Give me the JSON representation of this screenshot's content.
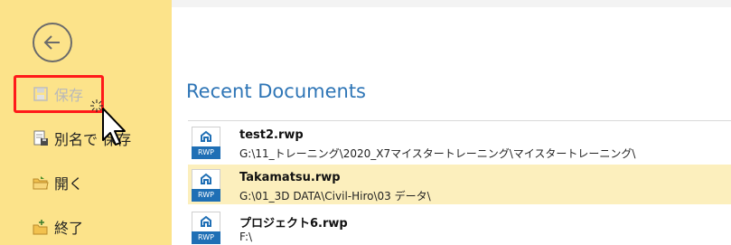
{
  "sidebar": {
    "back_icon": "arrow-left-circle-icon",
    "items": [
      {
        "label": "保存",
        "icon": "save-icon",
        "disabled": true
      },
      {
        "label": "別名で 保存",
        "icon": "save-as-icon"
      },
      {
        "label": "開く",
        "icon": "open-folder-icon"
      },
      {
        "label": "終了",
        "icon": "exit-icon"
      }
    ]
  },
  "main": {
    "heading": "Recent Documents",
    "documents": [
      {
        "name": "test2.rwp",
        "path": "G:\\11_トレーニング\\2020_X7マイスタートレーニング\\マイスタートレーニング\\",
        "icon_label": "RWP",
        "selected": false
      },
      {
        "name": "Takamatsu.rwp",
        "path": "G:\\01_3D DATA\\Civil-Hiro\\03 データ\\",
        "icon_label": "RWP",
        "selected": true
      },
      {
        "name": "プロジェクト6.rwp",
        "path": "F:\\",
        "icon_label": "RWP",
        "selected": false
      }
    ]
  },
  "colors": {
    "sidebar_bg": "#fce38a",
    "heading": "#2e75b6",
    "selected_row": "#fcefbd",
    "highlight_box": "#ff1a1a",
    "file_icon_band": "#1f6fb5"
  }
}
